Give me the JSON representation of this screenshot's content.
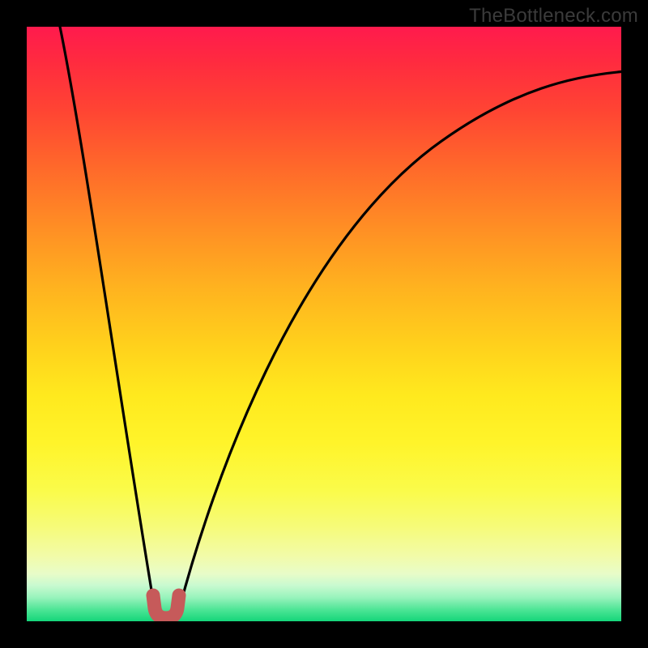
{
  "watermark": {
    "text": "TheBottleneck.com"
  },
  "chart_data": {
    "type": "line",
    "title": "",
    "xlabel": "",
    "ylabel": "",
    "xlim": [
      0,
      1
    ],
    "ylim": [
      0,
      1
    ],
    "grid": false,
    "annotations": [],
    "series": [
      {
        "name": "left-branch",
        "x": [
          0.055,
          0.075,
          0.09,
          0.105,
          0.12,
          0.135,
          0.15,
          0.165,
          0.18,
          0.2,
          0.215
        ],
        "y": [
          1.0,
          0.87,
          0.77,
          0.67,
          0.57,
          0.47,
          0.37,
          0.27,
          0.17,
          0.06,
          0.02
        ]
      },
      {
        "name": "right-branch",
        "x": [
          0.255,
          0.28,
          0.31,
          0.35,
          0.4,
          0.46,
          0.53,
          0.61,
          0.7,
          0.8,
          0.9,
          1.0
        ],
        "y": [
          0.02,
          0.09,
          0.195,
          0.32,
          0.445,
          0.56,
          0.655,
          0.735,
          0.8,
          0.855,
          0.895,
          0.925
        ]
      },
      {
        "name": "minimum-marker",
        "x": [
          0.215,
          0.218,
          0.225,
          0.235,
          0.245,
          0.252,
          0.255
        ],
        "y": [
          0.035,
          0.018,
          0.01,
          0.008,
          0.01,
          0.018,
          0.035
        ]
      }
    ],
    "colors": {
      "curve": "#000000",
      "marker": "#c65a5a",
      "gradient_top": "#ff1a4d",
      "gradient_bottom": "#14d67a"
    }
  }
}
